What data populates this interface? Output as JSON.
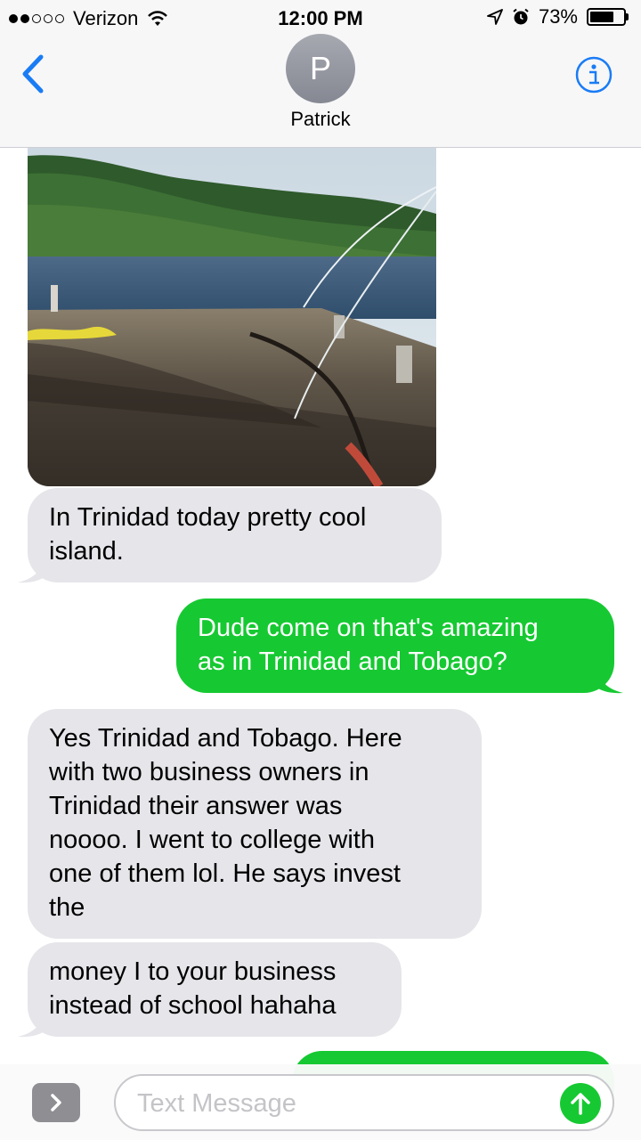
{
  "status_bar": {
    "carrier": "Verizon",
    "time": "12:00 PM",
    "battery_percent": "73%",
    "battery_level": 0.73,
    "signal_bars_filled": 2,
    "signal_bars_total": 5,
    "icons": [
      "signal-dots",
      "wifi-icon",
      "location-arrow-icon",
      "alarm-icon",
      "battery-icon"
    ]
  },
  "header": {
    "contact_initial": "P",
    "contact_name": "Patrick",
    "back_icon": "chevron-left-icon",
    "info_icon": "info-icon"
  },
  "messages": [
    {
      "type": "received",
      "kind": "photo",
      "description_icon": "photo-attachment"
    },
    {
      "type": "received",
      "lines": [
        "In Trinidad today pretty cool",
        "island."
      ]
    },
    {
      "type": "sent",
      "lines": [
        "Dude come on that's amazing",
        "as in Trinidad and Tobago?"
      ]
    },
    {
      "type": "received",
      "lines": [
        "Yes Trinidad and Tobago.  Here",
        "with two business owners in",
        "Trinidad their answer was",
        "noooo.  I went to college with",
        "one of them lol.  He says invest",
        "the"
      ]
    },
    {
      "type": "received",
      "lines": [
        "money I to your business",
        "instead of school hahaha"
      ]
    },
    {
      "type": "sent",
      "lines": []
    }
  ],
  "input_bar": {
    "placeholder": "Text Message",
    "value": "",
    "apps_icon": "chevron-right-icon",
    "send_icon": "arrow-up-icon"
  },
  "colors": {
    "sent_bubble": "#16c932",
    "received_bubble": "#e5e5ea",
    "ios_blue": "#1a7cf5",
    "header_bg": "#f7f7f8"
  }
}
